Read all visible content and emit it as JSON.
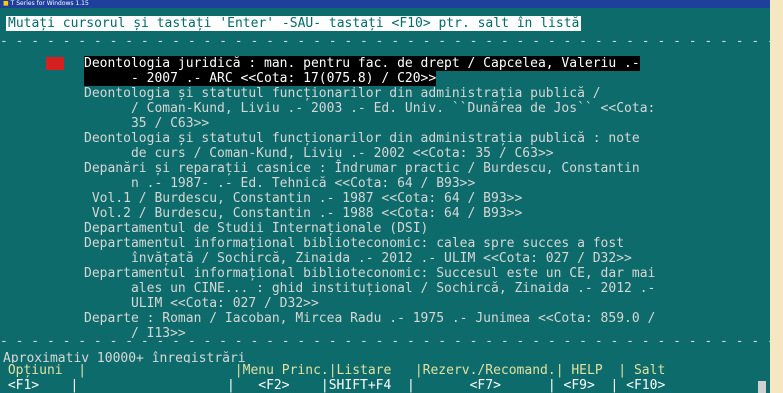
{
  "window": {
    "title": "T Series for Windows 1.15"
  },
  "prompt": "Mutați cursorul și tastați 'Enter' -SAU- tastați <F10> ptr. salt în listă",
  "records": [
    {
      "selected": true,
      "lines": [
        "Deontologia juridică : man. pentru fac. de drept / Capcelea, Valeriu .-",
        "      - 2007 .- ARC <<Cota: 17(075.8) / C20>>"
      ]
    },
    {
      "selected": false,
      "lines": [
        "Deontologia și statutul funcționarilor din administrația publică /",
        "      / Coman-Kund, Liviu .- 2003 .- Ed. Univ. ``Dunărea de Jos`` <<Cota:",
        "      35 / C63>>"
      ]
    },
    {
      "selected": false,
      "lines": [
        "Deontologia și statutul funcționarilor din administrația publică : note",
        "      de curs / Coman-Kund, Liviu .- 2002 <<Cota: 35 / C63>>"
      ]
    },
    {
      "selected": false,
      "lines": [
        "Depanări și reparații casnice : Îndrumar practic / Burdescu, Constantin",
        "      n .- 1987- .- Ed. Tehnică <<Cota: 64 / B93>>"
      ]
    },
    {
      "selected": false,
      "lines": [
        " Vol.1 / Burdescu, Constantin .- 1987 <<Cota: 64 / B93>>"
      ]
    },
    {
      "selected": false,
      "lines": [
        " Vol.2 / Burdescu, Constantin .- 1988 <<Cota: 64 / B93>>"
      ]
    },
    {
      "selected": false,
      "lines": [
        "Departamentul de Studii Internaționale (DSI)"
      ]
    },
    {
      "selected": false,
      "lines": [
        "Departamentul informațional biblioteconomic: calea spre succes a fost",
        "      învățată / Sochircă, Zinaida .- 2012 .- ULIM <<Cota: 027 / D32>>"
      ]
    },
    {
      "selected": false,
      "lines": [
        "Departamentul informațional biblioteconomic: Succesul este un CE, dar mai",
        "      ales un CINE... : ghid instituțional / Sochircă, Zinaida .- 2012 .-",
        "      ULIM <<Cota: 027 / D32>>"
      ]
    },
    {
      "selected": false,
      "lines": [
        "Departe : Roman / Iacoban, Mircea Radu .- 1975 .- Junimea <<Cota: 859.0 /",
        "      / I13>>"
      ]
    }
  ],
  "status": {
    "count": "Aproximativ 10000+ înregistrări"
  },
  "menu": {
    "labels_row": " Opțiuni  |                   |Menu Princ.|Listare   |Rezerv./Recomand.| HELP  | Salt",
    "keys_row": " <F1>    |                   |   <F2>    |SHIFT+F4  |       <F7>      | <F9>  | <F10>",
    "items": [
      {
        "label": "Opțiuni",
        "key": "<F1>"
      },
      {
        "label": "Menu Princ.",
        "key": "<F2>"
      },
      {
        "label": "Listare",
        "key": "SHIFT+F4"
      },
      {
        "label": "Rezerv./Recomand.",
        "key": "<F7>"
      },
      {
        "label": "HELP",
        "key": "<F9>"
      },
      {
        "label": "Salt",
        "key": "<F10>"
      }
    ]
  },
  "colors": {
    "screen": "#0d6b6b",
    "text": "#d6d6d6",
    "selection": "#000000",
    "marker": "#d62020",
    "menu_label": "#e0e0a0",
    "frame": "#f4e7c2",
    "titlebar": "#1f3f9c"
  }
}
